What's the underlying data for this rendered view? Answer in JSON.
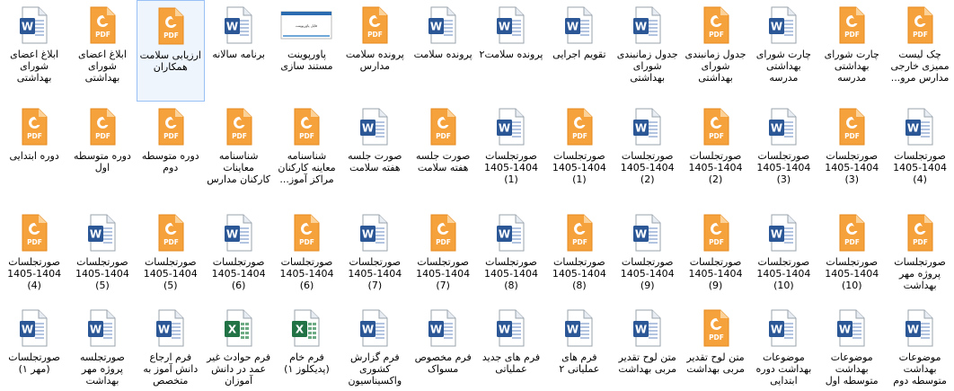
{
  "files": [
    {
      "label": "چک لیست ممیزی خارجی مدارس مرو...",
      "type": "pdf"
    },
    {
      "label": "چارت شورای بهداشتی مدرسه",
      "type": "pdf"
    },
    {
      "label": "چارت شورای بهداشتی مدرسه",
      "type": "word"
    },
    {
      "label": "جدول زمانبندی شورای بهداشتی",
      "type": "pdf"
    },
    {
      "label": "جدول زمانبندی شورای بهداشتی",
      "type": "word"
    },
    {
      "label": "تقویم اجرایی",
      "type": "word"
    },
    {
      "label": "پرونده سلامت۲",
      "type": "word"
    },
    {
      "label": "پرونده سلامت",
      "type": "word"
    },
    {
      "label": "پرونده سلامت مدارس",
      "type": "pdf"
    },
    {
      "label": "پاورپوینت مستند سازی",
      "type": "slide",
      "thumb_text": "فایل پاورپوینت"
    },
    {
      "label": "برنامه سالانه",
      "type": "word"
    },
    {
      "label": "ارزیابی سلامت همکاران",
      "type": "pdf",
      "selected": true
    },
    {
      "label": "ابلاغ اعضای شورای بهداشتی",
      "type": "pdf"
    },
    {
      "label": "ابلاغ اعضای شورای بهداشتی",
      "type": "word"
    },
    {
      "label": "صورتجلسات 1404-1405 (4)",
      "type": "word"
    },
    {
      "label": "صورتجلسات 1404-1405 (3)",
      "type": "pdf"
    },
    {
      "label": "صورتجلسات 1404-1405 (3)",
      "type": "word"
    },
    {
      "label": "صورتجلسات 1404-1405 (2)",
      "type": "pdf"
    },
    {
      "label": "صورتجلسات 1404-1405 (2)",
      "type": "word"
    },
    {
      "label": "صورتجلسات 1404-1405 (1)",
      "type": "pdf"
    },
    {
      "label": "صورتجلسات 1404-1405 (1)",
      "type": "word"
    },
    {
      "label": "صورت جلسه هفته سلامت",
      "type": "pdf"
    },
    {
      "label": "صورت جلسه هفته سلامت",
      "type": "word"
    },
    {
      "label": "شناسنامه معاینه کارکنان مراکز آموز...",
      "type": "pdf"
    },
    {
      "label": "شناسنامه معاینات کارکنان مدارس",
      "type": "pdf"
    },
    {
      "label": "دوره متوسطه دوم",
      "type": "pdf"
    },
    {
      "label": "دوره متوسطه اول",
      "type": "pdf"
    },
    {
      "label": "دوره ابتدایی",
      "type": "pdf"
    },
    {
      "label": "صورتجلسات پروژه مهر بهداشت",
      "type": "pdf"
    },
    {
      "label": "صورتجلسات 1404-1405 (10)",
      "type": "pdf"
    },
    {
      "label": "صورتجلسات 1404-1405 (10)",
      "type": "word"
    },
    {
      "label": "صورتجلسات 1404-1405 (9)",
      "type": "pdf"
    },
    {
      "label": "صورتجلسات 1404-1405 (9)",
      "type": "word"
    },
    {
      "label": "صورتجلسات 1404-1405 (8)",
      "type": "pdf"
    },
    {
      "label": "صورتجلسات 1404-1405 (8)",
      "type": "word"
    },
    {
      "label": "صورتجلسات 1404-1405 (7)",
      "type": "pdf"
    },
    {
      "label": "صورتجلسات 1404-1405 (7)",
      "type": "word"
    },
    {
      "label": "صورتجلسات 1404-1405 (6)",
      "type": "pdf"
    },
    {
      "label": "صورتجلسات 1404-1405 (6)",
      "type": "word"
    },
    {
      "label": "صورتجلسات 1404-1405 (5)",
      "type": "pdf"
    },
    {
      "label": "صورتجلسات 1404-1405 (5)",
      "type": "word"
    },
    {
      "label": "صورتجلسات 1404-1405 (4)",
      "type": "pdf"
    },
    {
      "label": "موضوعات بهداشت متوسطه دوم",
      "type": "word"
    },
    {
      "label": "موضوعات بهداشت متوسطه اول",
      "type": "word"
    },
    {
      "label": "موضوعات بهداشت دوره ابتدایی",
      "type": "word"
    },
    {
      "label": "متن لوح تقدیر مربی بهداشت",
      "type": "pdf"
    },
    {
      "label": "متن لوح تقدیر مربی بهداشت",
      "type": "word"
    },
    {
      "label": "فرم های عملیاتی ۲",
      "type": "word"
    },
    {
      "label": "فرم های جدید عملیاتی",
      "type": "word"
    },
    {
      "label": "فرم مخصوص مسواک",
      "type": "word"
    },
    {
      "label": "فرم گزارش کشوری واکسیناسیون",
      "type": "word"
    },
    {
      "label": "فرم خام (پدیکلوز ۱)",
      "type": "excel"
    },
    {
      "label": "فرم حوادث غیر عمد در دانش آموزان",
      "type": "excel"
    },
    {
      "label": "فرم ارجاع دانش آموز به متخصص",
      "type": "word"
    },
    {
      "label": "صورتجلسه پروژه مهر بهداشت",
      "type": "word"
    },
    {
      "label": "صورتجلسات (مهر ۱)",
      "type": "word"
    }
  ],
  "colors": {
    "word_blue": "#2b5797",
    "pdf_orange": "#f6a23c",
    "excel_green": "#217346",
    "selection_border": "#99c1f5",
    "selection_fill": "#eef5fd"
  },
  "icon_names": {
    "word": "word-document-icon",
    "pdf": "pdf-document-icon",
    "excel": "excel-spreadsheet-icon",
    "slide": "powerpoint-thumbnail-icon"
  }
}
